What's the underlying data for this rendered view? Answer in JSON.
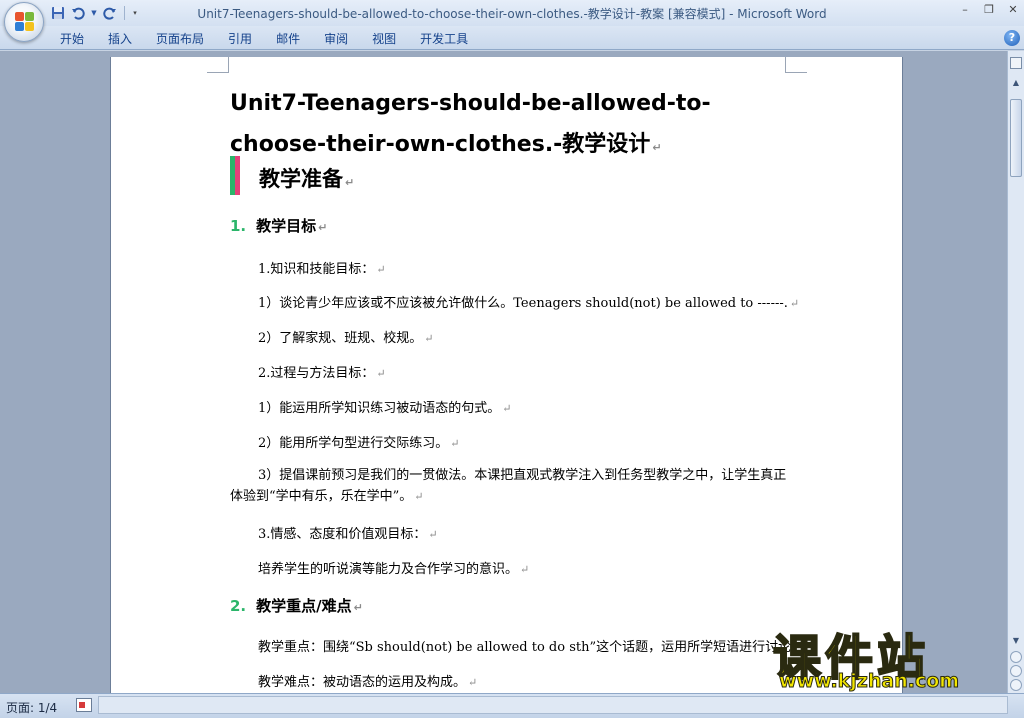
{
  "window": {
    "title": "Unit7-Teenagers-should-be-allowed-to-choose-their-own-clothes.-教学设计-教案 [兼容模式]",
    "separator": " - ",
    "app_name": "Microsoft Word",
    "controls": [
      "–",
      "❐",
      "✕"
    ]
  },
  "ribbon": {
    "tabs": [
      "开始",
      "插入",
      "页面布局",
      "引用",
      "邮件",
      "审阅",
      "视图",
      "开发工具"
    ],
    "help": "?"
  },
  "document": {
    "title": "Unit7-Teenagers-should-be-allowed-to-choose-their-own-clothes.-教学设计",
    "section": "教学准备",
    "para_mark": "↵",
    "h1": {
      "num": "1.",
      "text": "教学目标"
    },
    "p1": "1.知识和技能目标：",
    "p2": "1）谈论青少年应该或不应该被允许做什么。Teenagers should(not) be allowed to ------.",
    "p3": "2）了解家规、班规、校规。",
    "p4": "2.过程与方法目标：",
    "p5": "1）能运用所学知识练习被动语态的句式。",
    "p6": "2）能用所学句型进行交际练习。",
    "p7": "3）提倡课前预习是我们的一贯做法。本课把直观式教学注入到任务型教学之中，让学生真正体验到“学中有乐，乐在学中”。",
    "p8": "3.情感、态度和价值观目标：",
    "p9": "培养学生的听说演等能力及合作学习的意识。",
    "h2": {
      "num": "2.",
      "text": "教学重点/难点"
    },
    "p10": "教学重点：围绕“Sb should(not) be allowed to do sth”这个话题，运用所学短语进行讨论",
    "p11": "教学难点：被动语态的运用及构成。"
  },
  "watermark": {
    "main": "课件站",
    "url": "www.kjzhan.com"
  },
  "status": {
    "page": "页面: 1/4"
  },
  "colors": {
    "accent_green": "#2bb56a",
    "accent_pink": "#e5407a",
    "ribbon_text": "#15428b"
  }
}
